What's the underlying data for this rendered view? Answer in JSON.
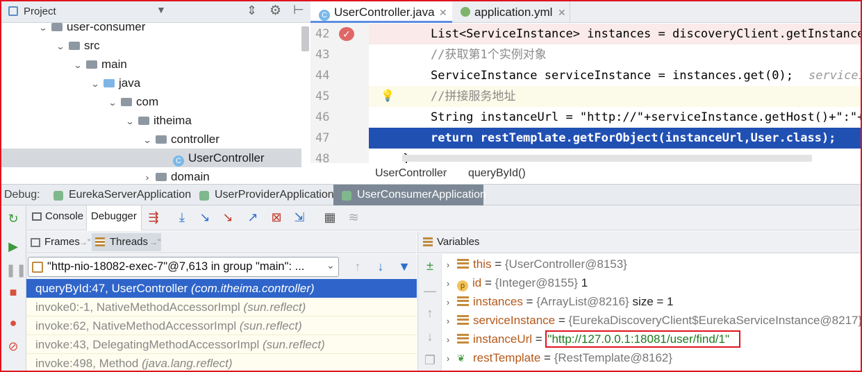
{
  "project": {
    "title": "Project",
    "tree": [
      {
        "label": "user-consumer",
        "depth": 0,
        "arrow": "open",
        "icon": "module"
      },
      {
        "label": "src",
        "depth": 1,
        "arrow": "open",
        "icon": "folder"
      },
      {
        "label": "main",
        "depth": 2,
        "arrow": "open",
        "icon": "folder"
      },
      {
        "label": "java",
        "depth": 3,
        "arrow": "open",
        "icon": "source-folder"
      },
      {
        "label": "com",
        "depth": 4,
        "arrow": "open",
        "icon": "package"
      },
      {
        "label": "itheima",
        "depth": 5,
        "arrow": "open",
        "icon": "package"
      },
      {
        "label": "controller",
        "depth": 6,
        "arrow": "open",
        "icon": "package"
      },
      {
        "label": "UserController",
        "depth": 7,
        "arrow": "none",
        "icon": "class",
        "selected": true
      },
      {
        "label": "domain",
        "depth": 6,
        "arrow": "closed",
        "icon": "package"
      }
    ]
  },
  "editor": {
    "tabs": [
      {
        "label": "UserController.java",
        "active": true
      },
      {
        "label": "application.yml",
        "active": false
      }
    ],
    "lines": [
      {
        "num": "42",
        "text": "List<ServiceInstance> instances = discoveryClient.getInstance",
        "highlight": "pink",
        "marker": "breakpoint"
      },
      {
        "num": "43",
        "text": "//获取第1个实例对象",
        "kind": "comment"
      },
      {
        "num": "44",
        "text": "ServiceInstance serviceInstance = instances.get(0);",
        "hint": "serviceIn"
      },
      {
        "num": "45",
        "text": "//拼接服务地址",
        "kind": "comment",
        "highlight": "cream",
        "marker": "bulb"
      },
      {
        "num": "46",
        "text": "String instanceUrl = \"http://\"+serviceInstance.getHost()+\":\"+"
      },
      {
        "num": "47",
        "text": "return restTemplate.getForObject(instanceUrl,User.class);",
        "highlight": "blue"
      },
      {
        "num": "48",
        "text": "}"
      }
    ],
    "breadcrumb": [
      "UserController",
      "queryById()"
    ]
  },
  "debug": {
    "label": "Debug:",
    "apps": [
      {
        "label": "EurekaServerApplication",
        "active": false
      },
      {
        "label": "UserProviderApplication",
        "active": false
      },
      {
        "label": "UserConsumerApplication",
        "active": true
      }
    ],
    "subtabs": [
      "Console",
      "Debugger"
    ],
    "frames_header": "Frames",
    "threads_header": "Threads",
    "thread_select": "\"http-nio-18082-exec-7\"@7,613 in group \"main\": ...",
    "frames": [
      {
        "method": "queryById:47, UserController",
        "pkg": "(com.itheima.controller)",
        "selected": true
      },
      {
        "method": "invoke0:-1, NativeMethodAccessorImpl",
        "pkg": "(sun.reflect)"
      },
      {
        "method": "invoke:62, NativeMethodAccessorImpl",
        "pkg": "(sun.reflect)"
      },
      {
        "method": "invoke:43, DelegatingMethodAccessorImpl",
        "pkg": "(sun.reflect)"
      },
      {
        "method": "invoke:498, Method",
        "pkg": "(java.lang.reflect)"
      }
    ],
    "variables_header": "Variables",
    "variables": [
      {
        "name": "this",
        "type": "{UserController@8153}",
        "value": "",
        "icon": "field"
      },
      {
        "name": "id",
        "type": "{Integer@8155}",
        "value": "1",
        "icon": "param"
      },
      {
        "name": "instances",
        "type": "{ArrayList@8216}",
        "value": " size = 1",
        "icon": "field"
      },
      {
        "name": "serviceInstance",
        "type": "{EurekaDiscoveryClient$EurekaServiceInstance@8217}",
        "value": "",
        "icon": "field"
      },
      {
        "name": "instanceUrl",
        "type": "",
        "value": "\"http://127.0.0.1:18081/user/find/1\"",
        "icon": "field",
        "boxed": true
      },
      {
        "name": "restTemplate",
        "type": "{RestTemplate@8162}",
        "value": "",
        "icon": "spring"
      }
    ]
  },
  "colors": {
    "accent": "#2f65ca",
    "highlight_box": "#e0141e",
    "breakpoint": "#e06767"
  }
}
